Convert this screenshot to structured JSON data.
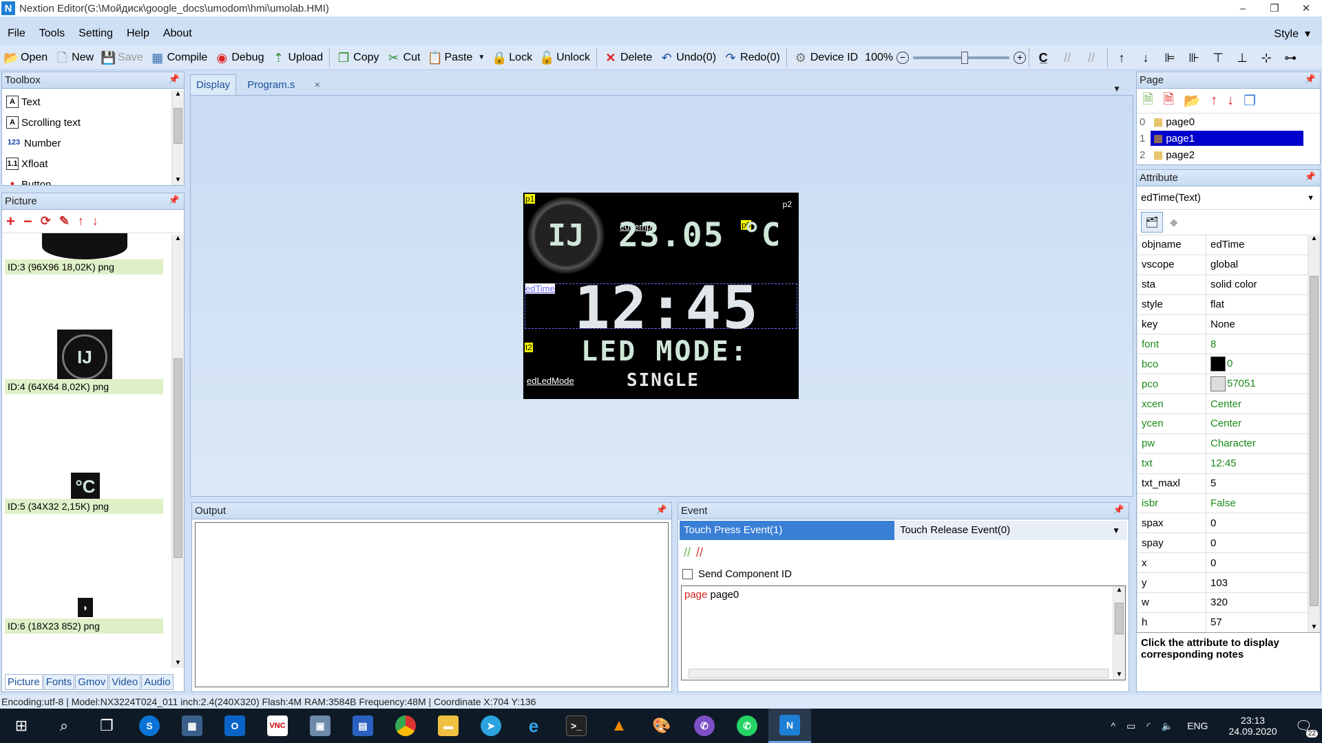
{
  "window": {
    "title": "Nextion Editor(G:\\Мойдиск\\google_docs\\umodom\\hmi\\umolab.HMI)",
    "minimize": "–",
    "restore": "❐",
    "close": "✕"
  },
  "menu": {
    "file": "File",
    "tools": "Tools",
    "setting": "Setting",
    "help": "Help",
    "about": "About",
    "style": "Style"
  },
  "toolbar": {
    "open": "Open",
    "new": "New",
    "save": "Save",
    "compile": "Compile",
    "debug": "Debug",
    "upload": "Upload",
    "copy": "Copy",
    "cut": "Cut",
    "paste": "Paste",
    "lock": "Lock",
    "unlock": "Unlock",
    "delete": "Delete",
    "undo": "Undo(0)",
    "redo": "Redo(0)",
    "device_id": "Device ID",
    "zoom": "100%"
  },
  "toolbox": {
    "title": "Toolbox",
    "items": [
      {
        "label": "Text",
        "icon": "A"
      },
      {
        "label": "Scrolling text",
        "icon": "A"
      },
      {
        "label": "Number",
        "icon": "123"
      },
      {
        "label": "Xfloat",
        "icon": "1.1"
      },
      {
        "label": "Button",
        "icon": "●"
      }
    ]
  },
  "picture": {
    "title": "Picture",
    "items": [
      {
        "caption": "ID:3  (96X96 18,02K) png"
      },
      {
        "caption": "ID:4  (64X64 8,02K) png"
      },
      {
        "caption": "ID:5  (34X32 2,15K) png"
      },
      {
        "caption": "ID:6  (18X23 852) png"
      }
    ],
    "tabs": [
      "Picture",
      "Fonts",
      "Gmov",
      "Video",
      "Audio"
    ]
  },
  "doc_tabs": {
    "display": "Display",
    "program": "Program.s",
    "close": "×"
  },
  "device": {
    "p1": "p1",
    "p2": "p2",
    "p0": "p0",
    "t2": "t2",
    "edTemp_label": "edTemp",
    "temp_value": "23.05",
    "unit": "°C",
    "edTime_label": "edTime",
    "time_value": "12:45",
    "led_mode": "LED MODE:",
    "edLedMode_label": "edLedMode",
    "mode_value": "SINGLE",
    "logo": "IJ"
  },
  "output": {
    "title": "Output"
  },
  "event": {
    "title": "Event",
    "tab_press": "Touch Press Event(1)",
    "tab_release": "Touch Release Event(0)",
    "send_component_id": "Send Component ID",
    "code_keyword": "page",
    "code_arg": " page0"
  },
  "page_panel": {
    "title": "Page",
    "pages": [
      {
        "index": "0",
        "name": "page0"
      },
      {
        "index": "1",
        "name": "page1"
      },
      {
        "index": "2",
        "name": "page2"
      }
    ]
  },
  "attribute": {
    "title": "Attribute",
    "selected": "edTime(Text)",
    "rows": [
      {
        "k": "objname",
        "v": "edTime",
        "green": false
      },
      {
        "k": "vscope",
        "v": "global",
        "green": false
      },
      {
        "k": "sta",
        "v": "solid color",
        "green": false
      },
      {
        "k": "style",
        "v": "flat",
        "green": false
      },
      {
        "k": "key",
        "v": "None",
        "green": false
      },
      {
        "k": "font",
        "v": "8",
        "green": true
      },
      {
        "k": "bco",
        "v": "0",
        "green": true,
        "swatch": "#000000"
      },
      {
        "k": "pco",
        "v": "57051",
        "green": true,
        "swatch": "#dcdcdc"
      },
      {
        "k": "xcen",
        "v": "Center",
        "green": true
      },
      {
        "k": "ycen",
        "v": "Center",
        "green": true
      },
      {
        "k": "pw",
        "v": "Character",
        "green": true
      },
      {
        "k": "txt",
        "v": "12:45",
        "green": true
      },
      {
        "k": "txt_maxl",
        "v": "5",
        "green": false
      },
      {
        "k": "isbr",
        "v": "False",
        "green": true
      },
      {
        "k": "spax",
        "v": "0",
        "green": false
      },
      {
        "k": "spay",
        "v": "0",
        "green": false
      },
      {
        "k": "x",
        "v": "0",
        "green": false
      },
      {
        "k": "y",
        "v": "103",
        "green": false
      },
      {
        "k": "w",
        "v": "320",
        "green": false
      },
      {
        "k": "h",
        "v": "57",
        "green": false
      }
    ],
    "note": "Click the attribute to display corresponding notes"
  },
  "status": {
    "text": "Encoding:utf-8 | Model:NX3224T024_011 inch:2.4(240X320) Flash:4M RAM:3584B Frequency:48M |   Coordinate X:704  Y:136"
  },
  "taskbar": {
    "lang": "ENG",
    "time": "23:13",
    "date": "24.09.2020",
    "notif": "22"
  },
  "colors": {
    "accent": "#1e7fd6",
    "selected": "#0000cc",
    "green_attr": "#1a8a1a"
  }
}
